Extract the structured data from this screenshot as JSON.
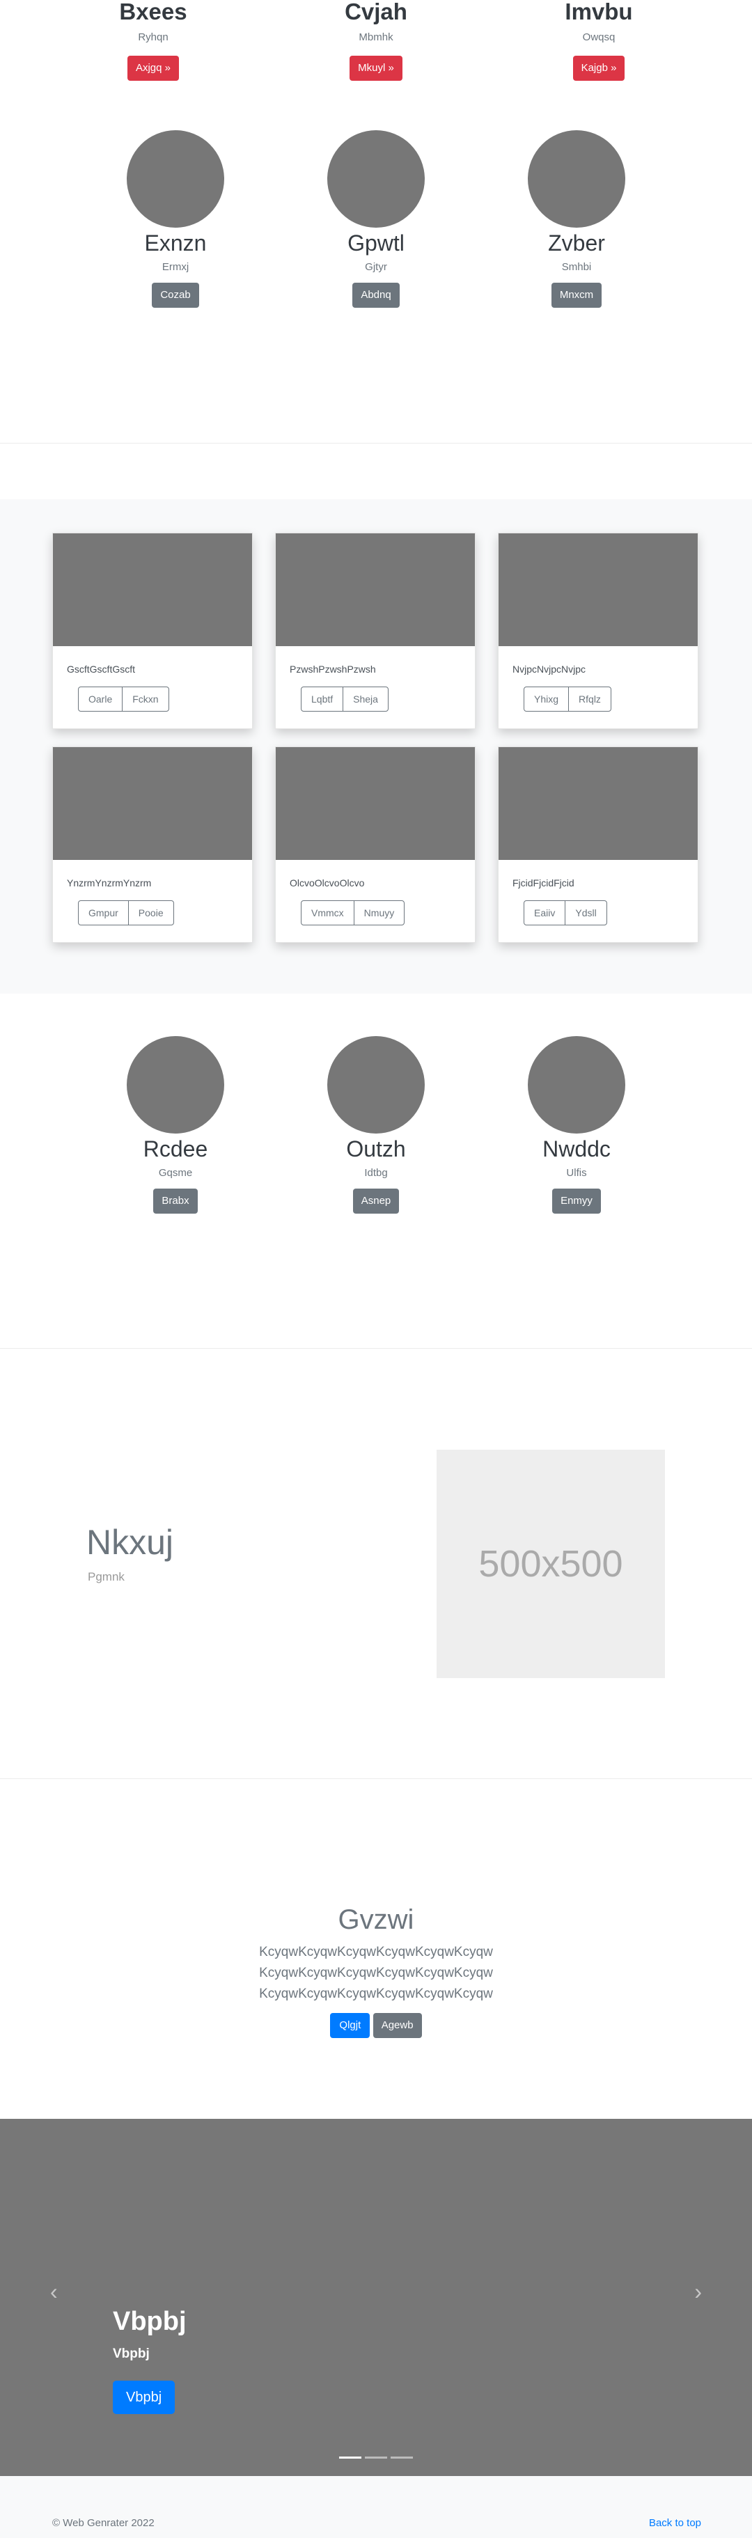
{
  "top_headings": [
    {
      "title": "Bxees",
      "subtitle": "Ryhqn",
      "button": "Axjgq »"
    },
    {
      "title": "Cvjah",
      "subtitle": "Mbmhk",
      "button": "Mkuyl »"
    },
    {
      "title": "Imvbu",
      "subtitle": "Owqsq",
      "button": "Kajgb »"
    }
  ],
  "circles_1": [
    {
      "name": "Exnzn",
      "subtitle": "Ermxj",
      "button": "Cozab"
    },
    {
      "name": "Gpwtl",
      "subtitle": "Gjtyr",
      "button": "Abdnq"
    },
    {
      "name": "Zvber",
      "subtitle": "Smhbi",
      "button": "Mnxcm"
    }
  ],
  "cards": [
    {
      "text": "GscftGscftGscft",
      "buttons": [
        "Oarle",
        "Fckxn"
      ]
    },
    {
      "text": "PzwshPzwshPzwsh",
      "buttons": [
        "Lqbtf",
        "Sheja"
      ]
    },
    {
      "text": "NvjpcNvjpcNvjpc",
      "buttons": [
        "Yhixg",
        "Rfqlz"
      ]
    },
    {
      "text": "YnzrmYnzrmYnzrm",
      "buttons": [
        "Gmpur",
        "Pooie"
      ]
    },
    {
      "text": "OlcvoOlcvoOlcvo",
      "buttons": [
        "Vmmcx",
        "Nmuyy"
      ]
    },
    {
      "text": "FjcidFjcidFjcid",
      "buttons": [
        "Eaiiv",
        "Ydsll"
      ]
    }
  ],
  "circles_2": [
    {
      "name": "Rcdee",
      "subtitle": "Gqsme",
      "button": "Brabx"
    },
    {
      "name": "Outzh",
      "subtitle": "Idtbg",
      "button": "Asnep"
    },
    {
      "name": "Nwddc",
      "subtitle": "Ulfis",
      "button": "Enmyy"
    }
  ],
  "featurette": {
    "title": "Nkxuj",
    "subtitle": "Pgmnk",
    "placeholder": "500x500"
  },
  "jumbotron": {
    "title": "Gvzwi",
    "lead_lines": [
      "KcyqwKcyqwKcyqwKcyqwKcyqwKcyqw",
      "KcyqwKcyqwKcyqwKcyqwKcyqwKcyqw",
      "KcyqwKcyqwKcyqwKcyqwKcyqwKcyqw"
    ],
    "primary_button": "Qlgjt",
    "secondary_button": "Agewb"
  },
  "carousel": {
    "title": "Vbpbj",
    "subtitle": "Vbpbj",
    "button": "Vbpbj",
    "prev_icon": "‹",
    "next_icon": "›",
    "slides": 3,
    "active_slide": 1
  },
  "footer": {
    "copyright": "© Web Genrater 2022",
    "back_to_top": "Back to top"
  },
  "colors": {
    "danger": "#dc3545",
    "secondary": "#6c757d",
    "primary": "#007bff",
    "placeholder_gray": "#777777"
  }
}
